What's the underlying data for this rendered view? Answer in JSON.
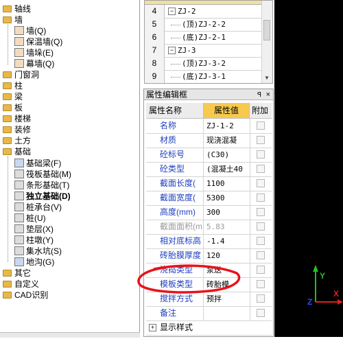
{
  "tree": {
    "items": [
      {
        "label": "轴线"
      },
      {
        "label": "墙"
      },
      {
        "label": "墙(Q)"
      },
      {
        "label": "保温墙(Q)"
      },
      {
        "label": "墙垛(E)"
      },
      {
        "label": "幕墙(Q)"
      },
      {
        "label": "门窗洞"
      },
      {
        "label": "柱"
      },
      {
        "label": "梁"
      },
      {
        "label": "板"
      },
      {
        "label": "楼梯"
      },
      {
        "label": "装修"
      },
      {
        "label": "土方"
      },
      {
        "label": "基础"
      },
      {
        "label": "基础梁(F)"
      },
      {
        "label": "筏板基础(M)"
      },
      {
        "label": "条形基础(T)"
      },
      {
        "label": "独立基础(D)"
      },
      {
        "label": "桩承台(V)"
      },
      {
        "label": "桩(U)"
      },
      {
        "label": "垫层(X)"
      },
      {
        "label": "柱墩(Y)"
      },
      {
        "label": "集水坑(S)"
      },
      {
        "label": "地沟(G)"
      },
      {
        "label": "其它"
      },
      {
        "label": "自定义"
      },
      {
        "label": "CAD识别"
      }
    ]
  },
  "component_list": {
    "rows": [
      {
        "num": "4",
        "expander": "−",
        "text": "ZJ-2"
      },
      {
        "num": "5",
        "text": "(顶)ZJ-2-2"
      },
      {
        "num": "6",
        "text": "(底)ZJ-2-1"
      },
      {
        "num": "7",
        "expander": "−",
        "text": "ZJ-3"
      },
      {
        "num": "8",
        "text": "(顶)ZJ-3-2"
      },
      {
        "num": "9",
        "text": "(底)ZJ-3-1"
      }
    ]
  },
  "property_editor": {
    "title": "属性编辑框",
    "pin_glyph": "ꟼ",
    "close_glyph": "×",
    "col_name": "属性名称",
    "col_value": "属性值",
    "col_extra": "附加",
    "rows": [
      {
        "name": "名称",
        "value": "ZJ-1-2"
      },
      {
        "name": "材质",
        "value": "现浇混凝"
      },
      {
        "name": "砼标号",
        "value": "(C30)"
      },
      {
        "name": "砼类型",
        "value": "(混凝土40"
      },
      {
        "name": "截面长度(",
        "value": "1100"
      },
      {
        "name": "截面宽度(",
        "value": "5300"
      },
      {
        "name": "高度(mm)",
        "value": "300"
      },
      {
        "name": "截面面积(m",
        "value": "5.83"
      },
      {
        "name": "相对底标高",
        "value": "-1.4"
      },
      {
        "name": "砖胎膜厚度",
        "value": "120"
      },
      {
        "name": "浇捣类型",
        "value": "泵送"
      },
      {
        "name": "模板类型",
        "value": "砖胎模"
      },
      {
        "name": "搅拌方式",
        "value": "预拌"
      },
      {
        "name": "备注",
        "value": ""
      },
      {
        "name": "显示样式",
        "value": ""
      }
    ],
    "expander_plus": "+"
  },
  "colors": {
    "highlight_circle": "#e8131b",
    "header_value_bg": "#f7c94e",
    "name_text": "#1f3fbf"
  },
  "axes": {
    "x_label": "X",
    "y_label": "Y",
    "z_label": "Z"
  }
}
